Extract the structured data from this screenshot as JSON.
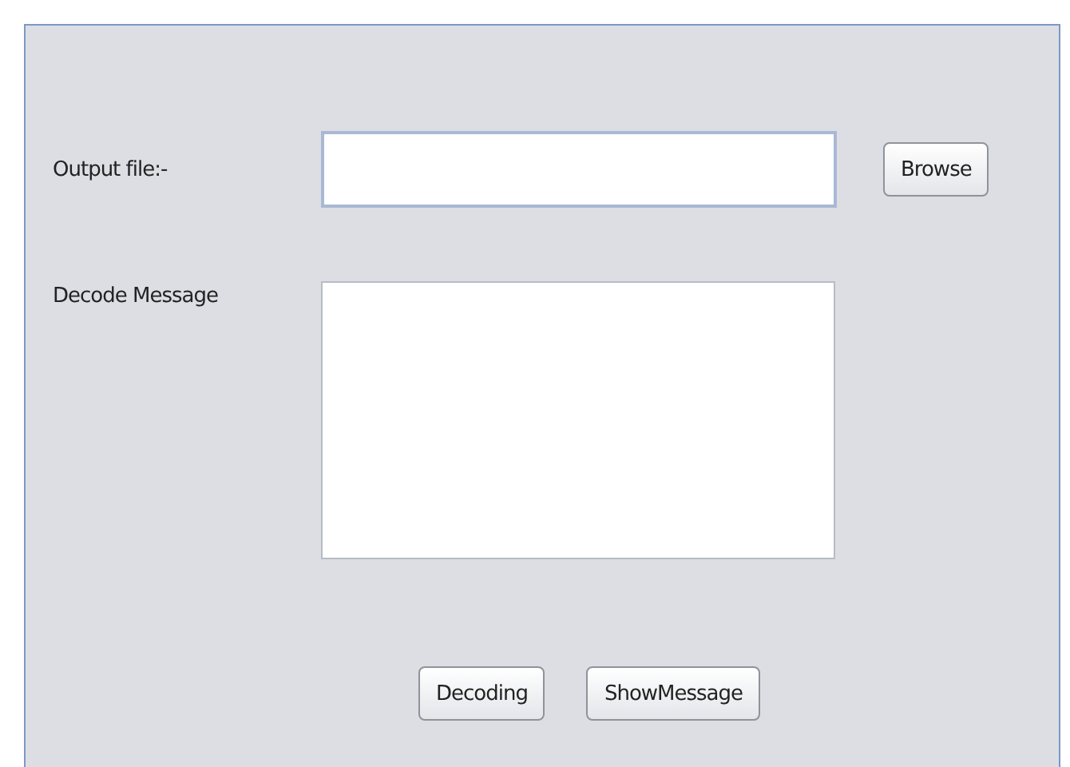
{
  "output_file": {
    "label": "Output file:-",
    "button": "Browse"
  },
  "decode_message": {
    "label": "Decode Message"
  },
  "buttons": [
    "Decoding",
    "ShowMessage"
  ]
}
